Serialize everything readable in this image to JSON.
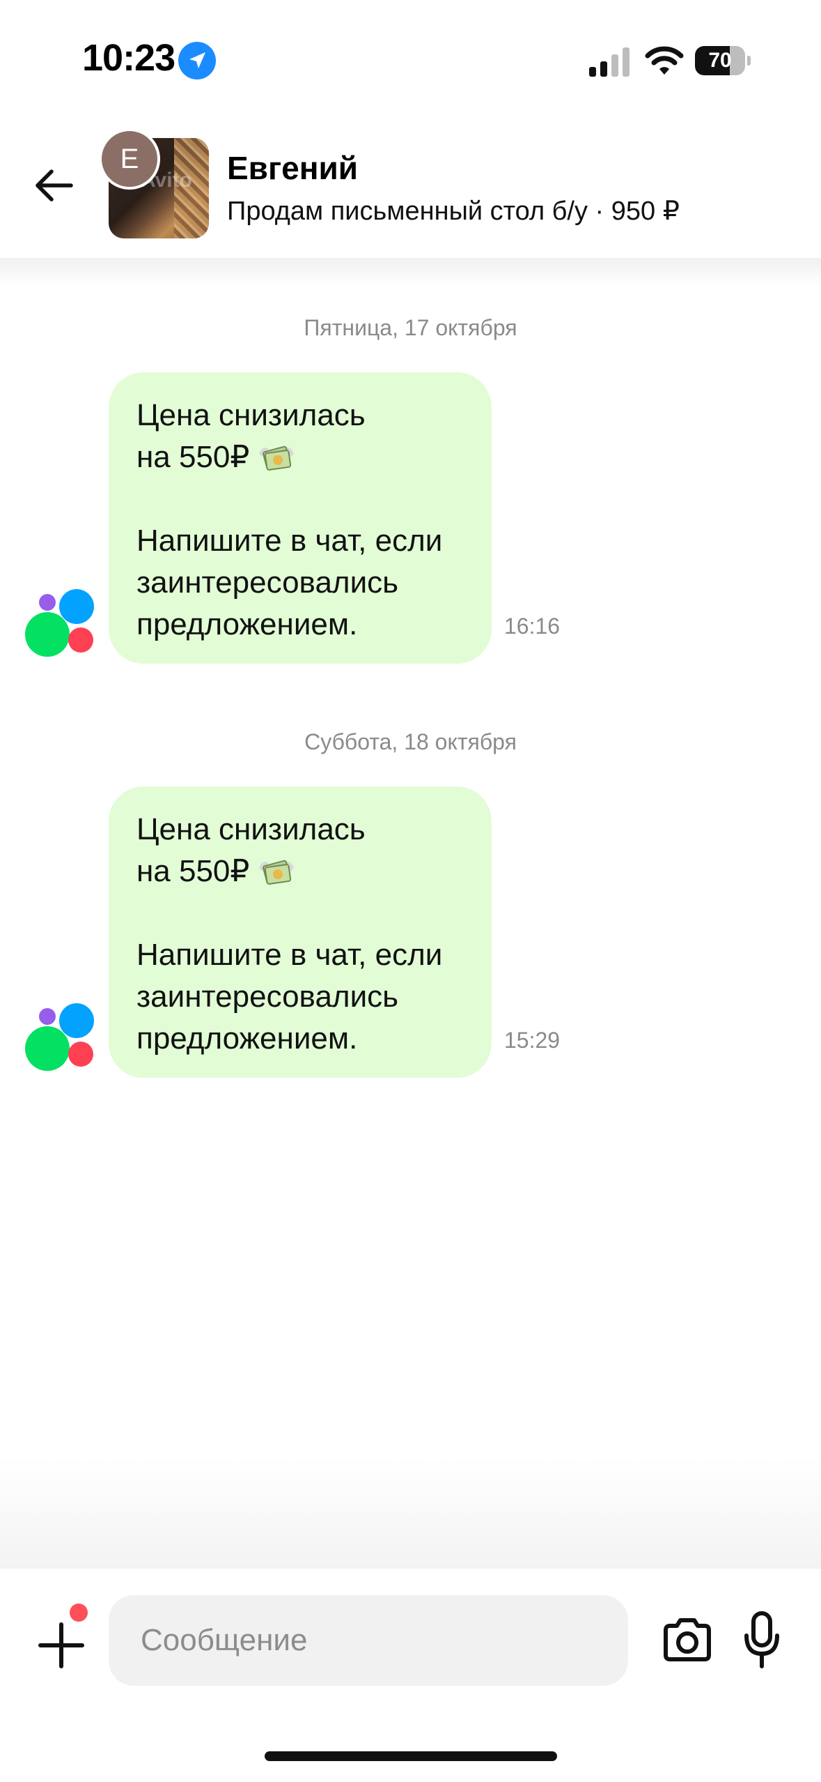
{
  "status_bar": {
    "time": "10:23",
    "battery_level": "70",
    "battery_fraction": 0.7
  },
  "header": {
    "seller_name": "Евгений",
    "seller_initial": "Е",
    "listing_info": "Продам письменный стол б/у · 950 ₽",
    "thumb_watermark": "Avito"
  },
  "messages": [
    {
      "date": "Пятница, 17 октября",
      "line1": "Цена снизилась",
      "line2": "на 550₽",
      "line3": "Напишите в чат, если",
      "line4": "заинтересовались",
      "line5": "предложением.",
      "time": "16:16"
    },
    {
      "date": "Суббота, 18 октября",
      "line1": "Цена снизилась",
      "line2": "на 550₽",
      "line3": "Напишите в чат, если",
      "line4": "заинтересовались",
      "line5": "предложением.",
      "time": "15:29"
    }
  ],
  "composer": {
    "placeholder": "Сообщение"
  },
  "colors": {
    "bubble": "#e2fdd6",
    "dot_purple": "#965eeb",
    "dot_blue": "#04a2ff",
    "dot_green": "#04e061",
    "dot_red": "#ff4053"
  }
}
